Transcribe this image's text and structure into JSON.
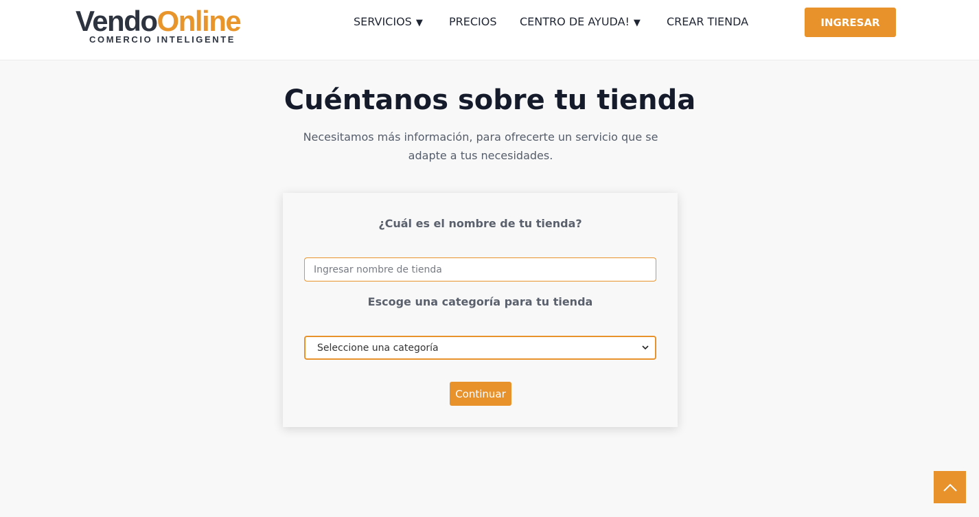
{
  "brand": {
    "name_part1": "Vendo",
    "name_part2": "Online",
    "tagline": "COMERCIO INTELIGENTE"
  },
  "nav": {
    "items": [
      {
        "label": "SERVICIOS",
        "dropdown": true
      },
      {
        "label": "PRECIOS",
        "dropdown": false
      },
      {
        "label": "CENTRO DE AYUDA!",
        "dropdown": true
      },
      {
        "label": "CREAR TIENDA",
        "dropdown": false
      }
    ],
    "dropdown_glyph": "▼",
    "login_label": "INGRESAR"
  },
  "hero": {
    "title": "Cuéntanos sobre tu tienda",
    "subtitle": "Necesitamos más información, para ofrecerte un servicio que se adapte a tus necesidades."
  },
  "form": {
    "store_name_label": "¿Cuál es el nombre de tu tienda?",
    "store_name_value": "",
    "store_name_placeholder": "Ingresar nombre de tienda",
    "category_label": "Escoge una categoría para tu tienda",
    "category_selected": "Seleccione una categoría",
    "continue_label": "Continuar"
  },
  "icons": {
    "dropdown": "chevron-down-icon",
    "scroll_top": "chevron-up-icon"
  },
  "colors": {
    "accent": "#e8922c",
    "dark": "#2d3440",
    "background": "#f8f8f8"
  }
}
